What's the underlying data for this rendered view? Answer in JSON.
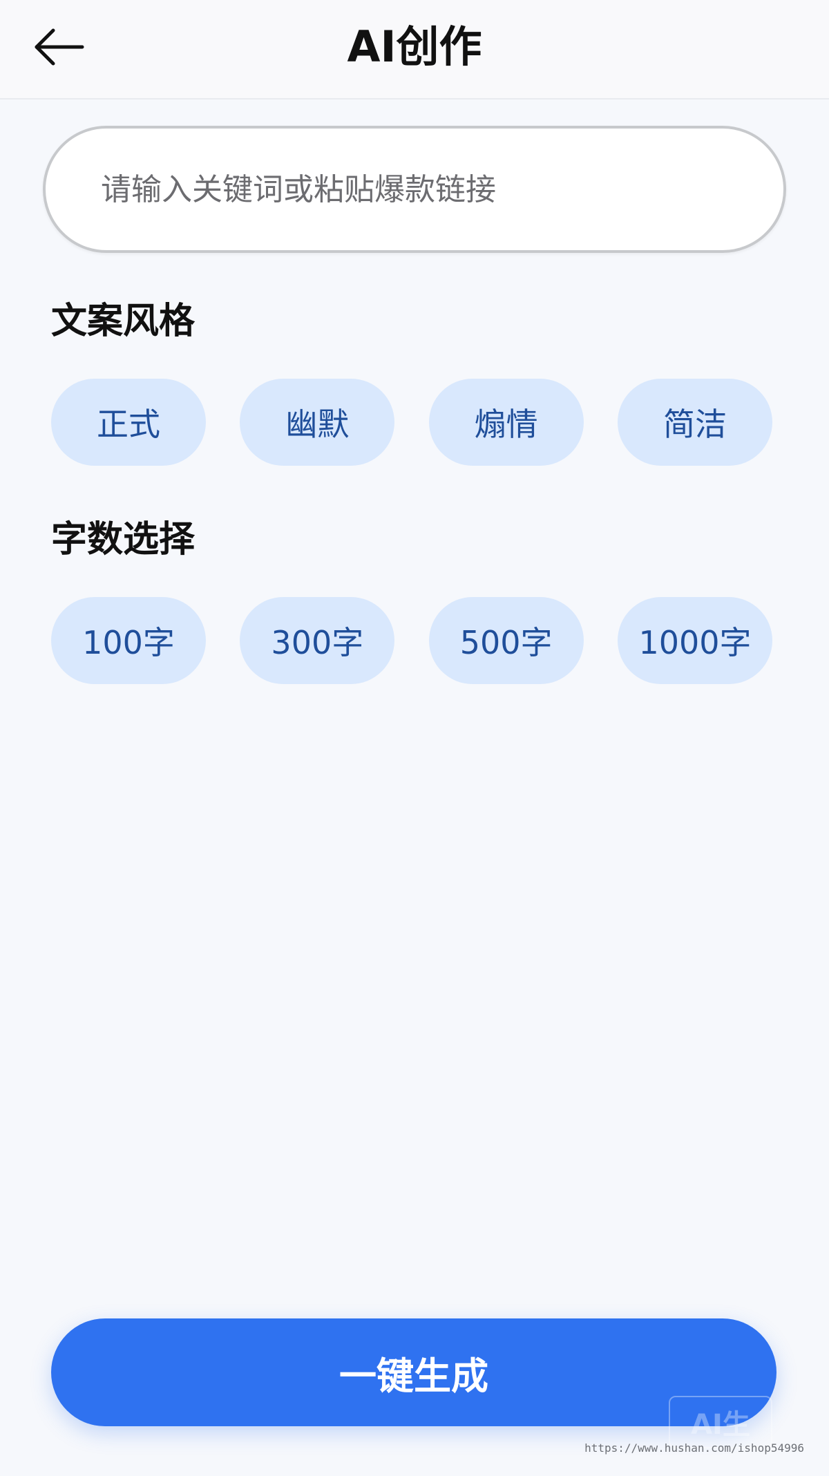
{
  "header": {
    "title": "AI创作",
    "back_icon": "arrow-left-icon"
  },
  "search": {
    "placeholder": "请输入关键词或粘贴爆款链接",
    "value": ""
  },
  "style_section": {
    "title": "文案风格",
    "options": [
      "正式",
      "幽默",
      "煽情",
      "简洁"
    ]
  },
  "length_section": {
    "title": "字数选择",
    "options": [
      "100字",
      "300字",
      "500字",
      "1000字"
    ]
  },
  "generate_button": {
    "label": "一键生成"
  },
  "watermark": {
    "badge": "AI生",
    "url": "https://www.hushan.com/ishop54996"
  },
  "colors": {
    "accent": "#2f72f0",
    "chip_bg": "#d9e8fd",
    "chip_text": "#1f4e9a",
    "page_bg": "#f6f8fc"
  }
}
